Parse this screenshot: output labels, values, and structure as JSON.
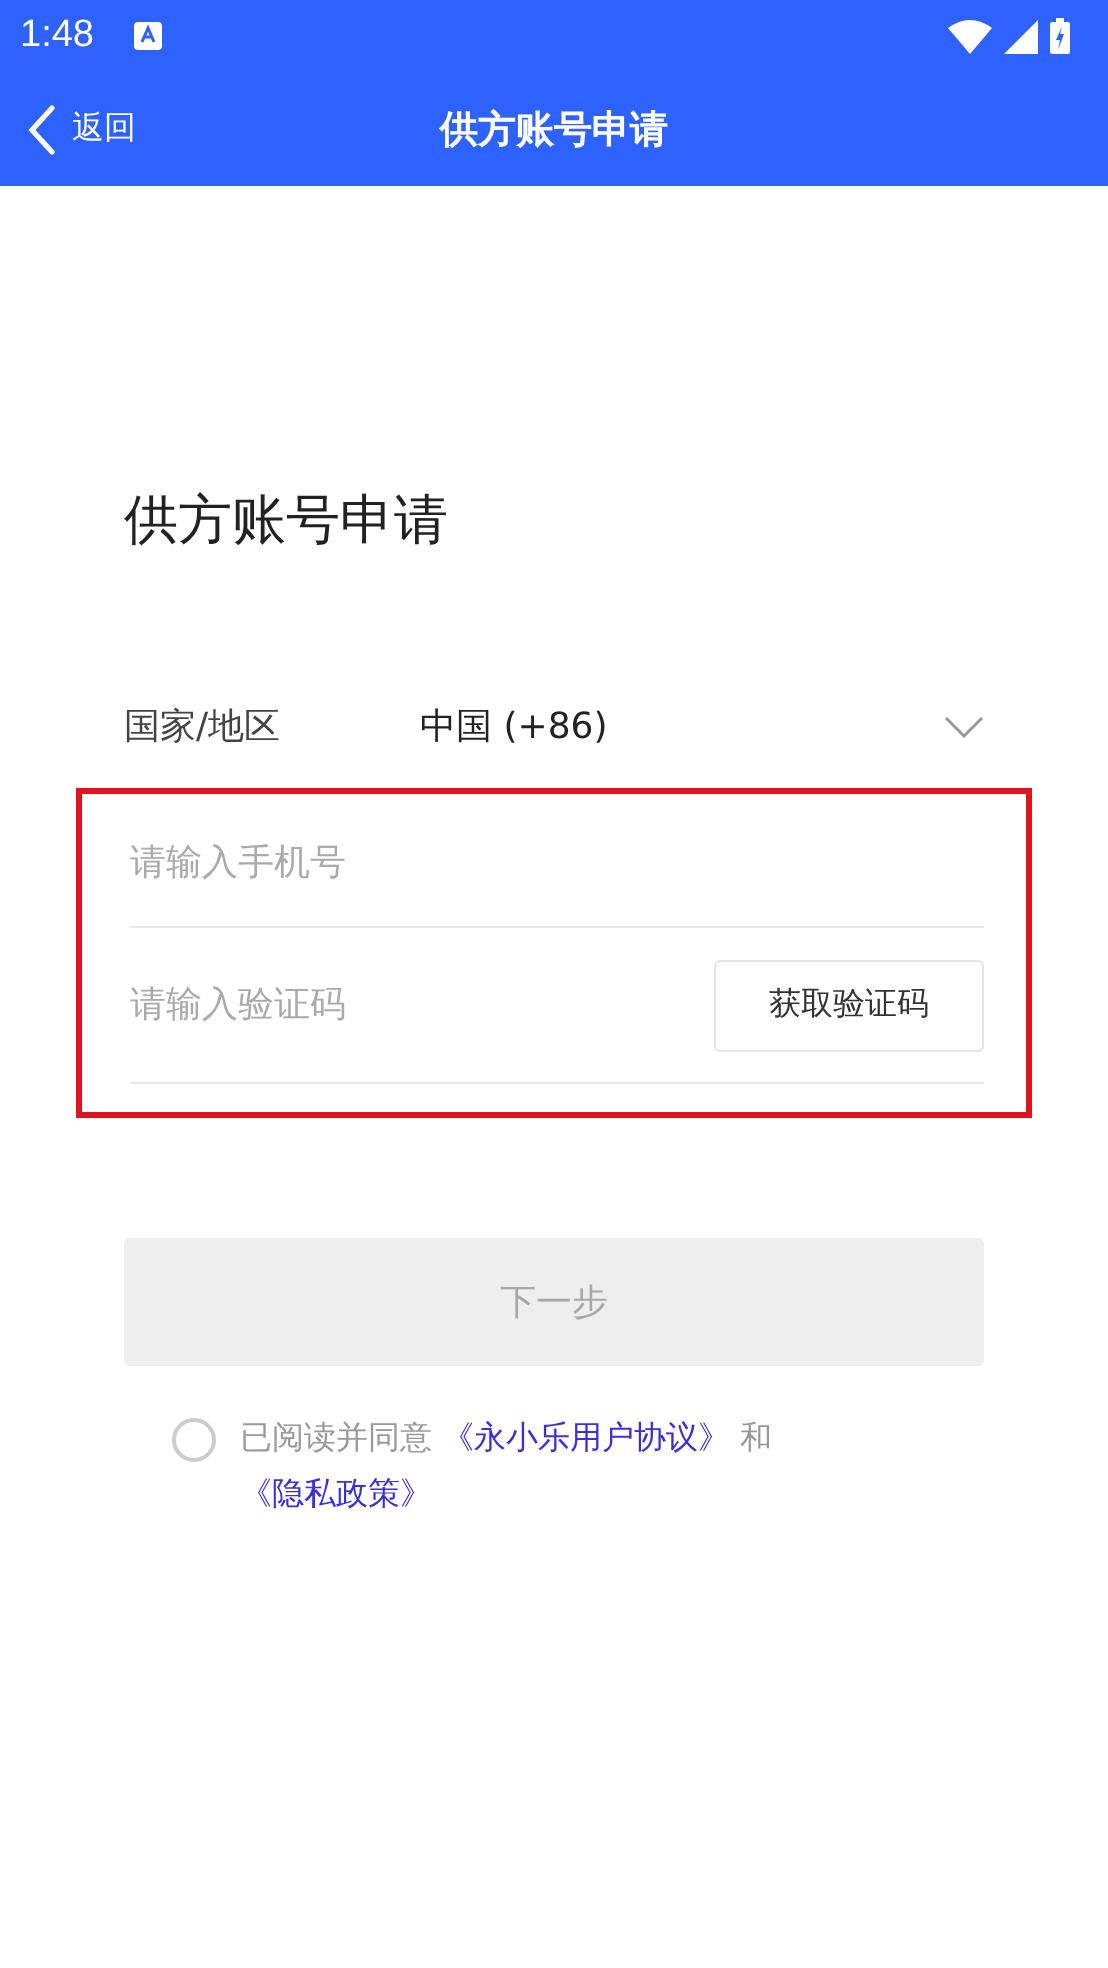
{
  "status_bar": {
    "time": "1:48"
  },
  "nav": {
    "back": "返回",
    "title": "供方账号申请"
  },
  "heading": "供方账号申请",
  "country": {
    "label": "国家/地区",
    "value": "中国 (+86)"
  },
  "credentials": {
    "highlighted": true,
    "phone": {
      "placeholder": "请输入手机号"
    },
    "code": {
      "placeholder": "请输入验证码",
      "button": "获取验证码"
    }
  },
  "next_button": {
    "label": "下一步",
    "disabled": true
  },
  "agreement": {
    "checked": false,
    "text": "已阅读并同意",
    "link_1": "《永小乐用户协议》",
    "joiner": "和",
    "link_2": "《隐私政策》"
  }
}
